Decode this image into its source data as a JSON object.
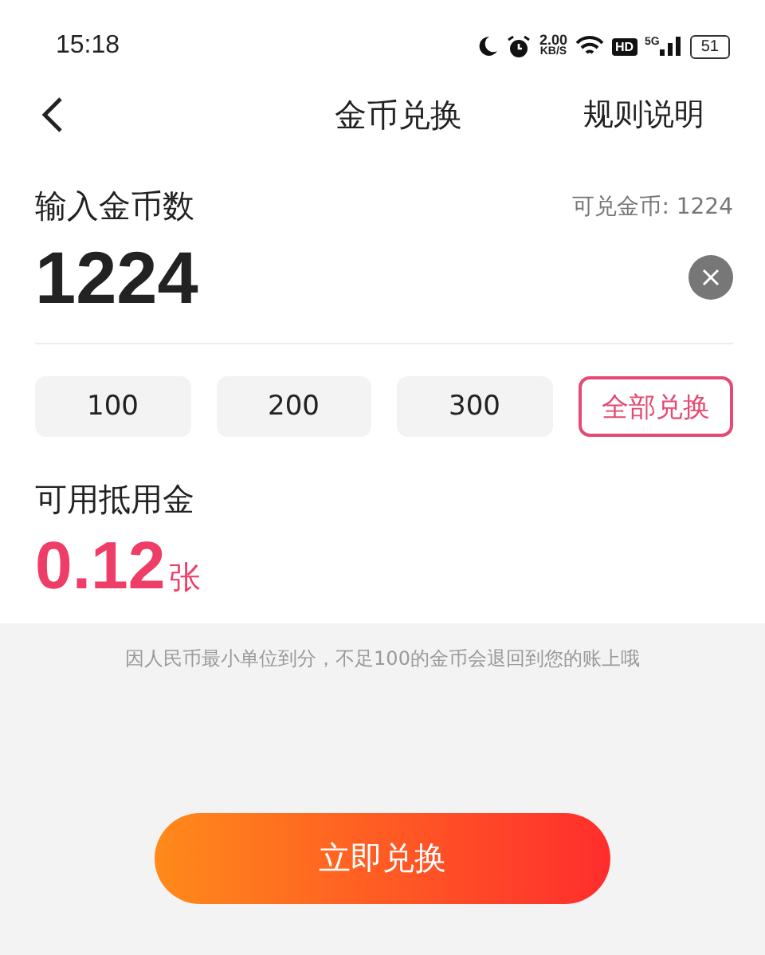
{
  "status_bar": {
    "time": "15:18",
    "speed_value": "2.00",
    "speed_unit": "KB/S",
    "hd": "HD",
    "network": "5G",
    "battery": "51"
  },
  "nav": {
    "title": "金币兑换",
    "action": "规则说明"
  },
  "input": {
    "label": "输入金币数",
    "available": "可兑金币: 1224",
    "value": "1224"
  },
  "quick_amounts": [
    {
      "label": "100",
      "selected": false
    },
    {
      "label": "200",
      "selected": false
    },
    {
      "label": "300",
      "selected": false
    },
    {
      "label": "全部兑换",
      "selected": true
    }
  ],
  "result": {
    "label": "可用抵用金",
    "value": "0.12",
    "unit": "张"
  },
  "notice": "因人民币最小单位到分，不足100的金币会退回到您的账上哦",
  "submit_button": "立即兑换"
}
